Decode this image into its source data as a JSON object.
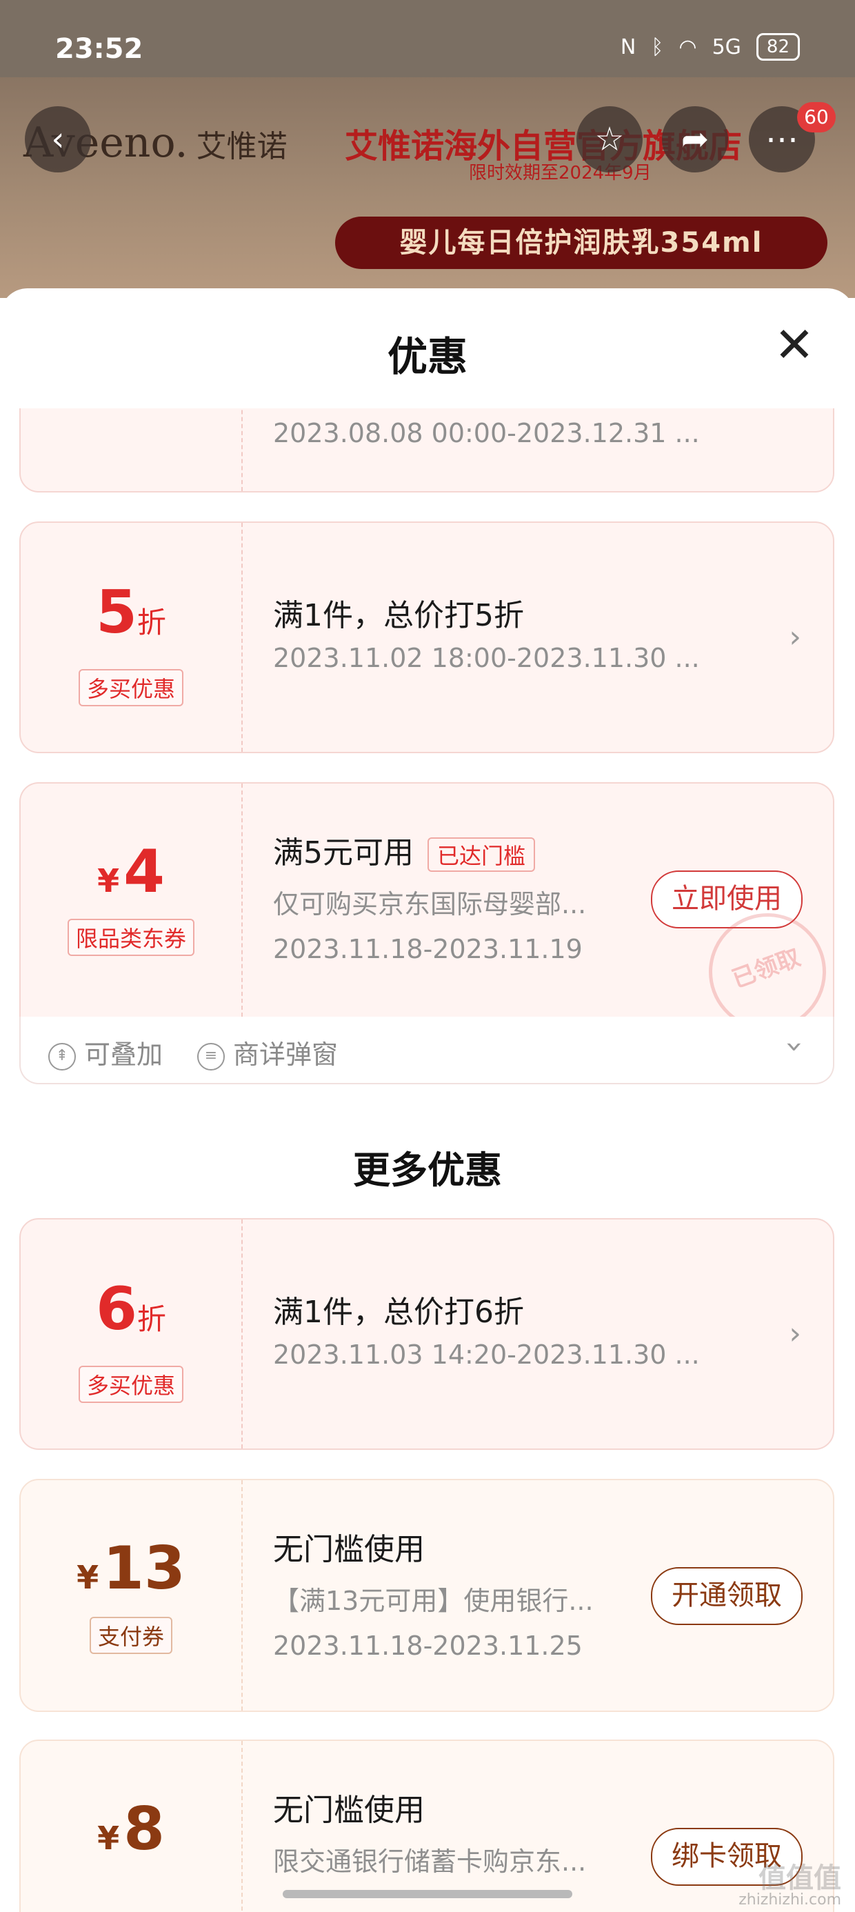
{
  "status_bar": {
    "time": "23:52",
    "network": "5G",
    "battery": "82"
  },
  "banner": {
    "brand": "Aveeno.",
    "brand_cn": "艾惟诺",
    "title": "艾惟诺海外自营官方旗舰店",
    "subtitle": "限时效期至2024年9月",
    "product_pill": "婴儿每日倍护润肤乳354ml",
    "notification_count": "60"
  },
  "sheet": {
    "title": "优惠"
  },
  "coupons": [
    {
      "big_value": "",
      "line2": "2023.08.08 00:00-2023.12.31 ..."
    },
    {
      "big_value": "5",
      "unit": "折",
      "tag": "多买优惠",
      "line1": "满1件，总价打5折",
      "line2": "2023.11.02 18:00-2023.11.30 ..."
    },
    {
      "yen": "¥",
      "big_value": "4",
      "tag": "限品类东券",
      "line1": "满5元可用",
      "badge": "已达门槛",
      "line2": "仅可购买京东国际母婴部...",
      "line3": "2023.11.18-2023.11.19",
      "action": "立即使用",
      "stamp": "已领取"
    }
  ],
  "card_footer": {
    "stackable": "可叠加",
    "popup": "商详弹窗"
  },
  "more_section": {
    "title": "更多优惠"
  },
  "more_coupons": [
    {
      "big_value": "6",
      "unit": "折",
      "tag": "多买优惠",
      "line1": "满1件，总价打6折",
      "line2": "2023.11.03 14:20-2023.11.30 ..."
    },
    {
      "yen": "¥",
      "big_value": "13",
      "tag": "支付券",
      "line1": "无门槛使用",
      "line2": "【满13元可用】使用银行...",
      "line3": "2023.11.18-2023.11.25",
      "action": "开通领取"
    },
    {
      "yen": "¥",
      "big_value": "8",
      "line1": "无门槛使用",
      "line2": "限交通银行储蓄卡购京东...",
      "action": "绑卡领取"
    }
  ],
  "watermark": {
    "logo": "值值值",
    "site": "zhizhizhi.com"
  }
}
